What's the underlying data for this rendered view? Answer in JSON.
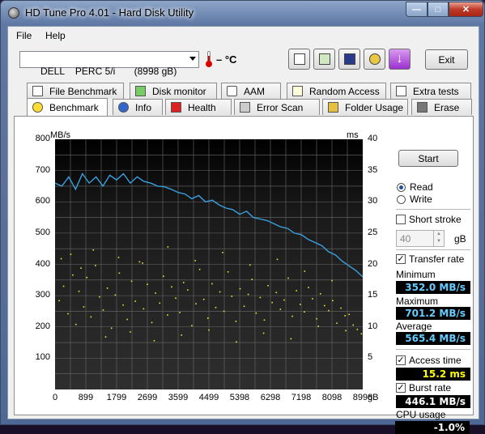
{
  "window": {
    "title": "HD Tune Pro 4.01 - Hard Disk Utility",
    "minimize": "—",
    "maximize": "□",
    "close": "✕"
  },
  "menu": [
    {
      "label": "File"
    },
    {
      "label": "Help"
    }
  ],
  "toolbar": {
    "drive_selected": "DELL    PERC 5/i       (8998 gB)",
    "temperature": "– °C",
    "exit_label": "Exit",
    "icons": [
      "copy-info-icon",
      "copy-screenshot-icon",
      "save-icon",
      "options-icon",
      "download-icon"
    ]
  },
  "tabs_back": [
    {
      "label": "File Benchmark",
      "icon": "file-benchmark-icon"
    },
    {
      "label": "Disk monitor",
      "icon": "disk-monitor-icon"
    },
    {
      "label": "AAM",
      "icon": "speaker-icon"
    },
    {
      "label": "Random Access",
      "icon": "random-access-icon"
    },
    {
      "label": "Extra tests",
      "icon": "extra-tests-icon"
    }
  ],
  "tabs_front": [
    {
      "label": "Benchmark",
      "icon": "benchmark-icon",
      "active": true
    },
    {
      "label": "Info",
      "icon": "info-icon"
    },
    {
      "label": "Health",
      "icon": "health-cross-icon"
    },
    {
      "label": "Error Scan",
      "icon": "error-scan-icon"
    },
    {
      "label": "Folder Usage",
      "icon": "folder-icon"
    },
    {
      "label": "Erase",
      "icon": "trash-icon"
    }
  ],
  "controls": {
    "start_label": "Start",
    "read_label": "Read",
    "write_label": "Write",
    "mode": "Read",
    "short_stroke_label": "Short stroke",
    "short_stroke_checked": false,
    "short_stroke_value": "40",
    "short_stroke_unit": "gB",
    "transfer_rate_label": "Transfer rate",
    "transfer_rate_checked": true,
    "minimum_label": "Minimum",
    "minimum_value": "352.0 MB/s",
    "maximum_label": "Maximum",
    "maximum_value": "701.2 MB/s",
    "average_label": "Average",
    "average_value": "565.4 MB/s",
    "access_time_label": "Access time",
    "access_time_checked": true,
    "access_time_value": "15.2 ms",
    "burst_rate_label": "Burst rate",
    "burst_rate_checked": true,
    "burst_rate_value": "446.1 MB/s",
    "cpu_usage_label": "CPU usage",
    "cpu_usage_value": "-1.0%"
  },
  "colors": {
    "transfer_line": "#3aa0e0",
    "access_points": "#e8e830",
    "chart_bg": "#000000",
    "grid": "#6a6a6a"
  },
  "chart_data": {
    "type": "line",
    "left_axis_label": "MB/s",
    "right_axis_label": "ms",
    "x_unit_label": "gB",
    "x_ticks": [
      "0",
      "899",
      "1799",
      "2699",
      "3599",
      "4499",
      "5398",
      "6298",
      "7198",
      "8098",
      "8998"
    ],
    "y_ticks_left": [
      "800",
      "700",
      "600",
      "500",
      "400",
      "300",
      "200",
      "100"
    ],
    "y_ticks_right": [
      "40",
      "35",
      "30",
      "25",
      "20",
      "15",
      "10",
      "5"
    ],
    "xlim": [
      0,
      8998
    ],
    "ylim_left": [
      0,
      800
    ],
    "ylim_right": [
      0,
      40
    ],
    "grid": true,
    "series": [
      {
        "name": "Transfer rate",
        "axis": "left",
        "x": [
          0,
          200,
          400,
          600,
          800,
          1000,
          1200,
          1400,
          1600,
          1800,
          2000,
          2200,
          2400,
          2600,
          2800,
          3000,
          3200,
          3400,
          3600,
          3800,
          4000,
          4200,
          4400,
          4600,
          4800,
          5000,
          5200,
          5400,
          5600,
          5800,
          6000,
          6200,
          6400,
          6600,
          6800,
          7000,
          7200,
          7400,
          7600,
          7800,
          8000,
          8200,
          8400,
          8600,
          8800,
          8998
        ],
        "y": [
          660,
          650,
          680,
          640,
          690,
          660,
          680,
          650,
          685,
          670,
          690,
          660,
          680,
          665,
          660,
          650,
          648,
          640,
          630,
          625,
          610,
          620,
          600,
          605,
          590,
          580,
          575,
          560,
          570,
          550,
          545,
          540,
          530,
          520,
          515,
          500,
          495,
          480,
          470,
          460,
          440,
          430,
          410,
          395,
          380,
          360
        ]
      },
      {
        "name": "Access time",
        "axis": "right",
        "type": "scatter",
        "x": [
          120,
          250,
          380,
          520,
          610,
          700,
          840,
          930,
          1050,
          1180,
          1300,
          1410,
          1530,
          1650,
          1760,
          1880,
          1990,
          2110,
          2240,
          2350,
          2470,
          2590,
          2700,
          2830,
          2940,
          3060,
          3170,
          3290,
          3410,
          3530,
          3650,
          3760,
          3880,
          4000,
          4120,
          4230,
          4350,
          4470,
          4590,
          4700,
          4820,
          4940,
          5060,
          5170,
          5290,
          5410,
          5530,
          5650,
          5760,
          5880,
          6000,
          6120,
          6230,
          6350,
          6470,
          6590,
          6700,
          6820,
          6940,
          7060,
          7170,
          7290,
          7410,
          7530,
          7650,
          7760,
          7880,
          8000,
          8120,
          8240,
          8360,
          8480,
          8600,
          8720,
          8840,
          8960,
          180,
          460,
          760,
          1120,
          1480,
          1860,
          2200,
          2560,
          2900,
          3300,
          3700,
          4100,
          4500,
          4900,
          5300,
          5700,
          6100,
          6500,
          6900,
          7300,
          7700,
          8100,
          8500
        ],
        "y": [
          14.2,
          16.5,
          12.1,
          18.3,
          10.4,
          15.7,
          13.2,
          17.9,
          11.6,
          19.8,
          14.8,
          12.7,
          16.2,
          9.8,
          15.1,
          18.6,
          13.5,
          11.2,
          17.3,
          14.1,
          20.4,
          12.9,
          16.8,
          10.7,
          15.4,
          13.8,
          18.1,
          11.9,
          16.4,
          14.6,
          12.3,
          17.1,
          15.9,
          10.2,
          13.7,
          19.2,
          14.4,
          11.4,
          16.9,
          13.1,
          15.6,
          12.5,
          18.8,
          14.9,
          10.9,
          16.1,
          13.3,
          15.2,
          17.6,
          12.2,
          14.7,
          11.1,
          16.6,
          13.9,
          15.5,
          12.8,
          14.3,
          17.8,
          11.7,
          15.8,
          13.6,
          12.4,
          16.3,
          14.5,
          11.3,
          15.3,
          13.4,
          12.6,
          14.2,
          10.6,
          13.0,
          11.8,
          12.0,
          10.3,
          9.6,
          8.9,
          20.9,
          21.6,
          19.4,
          22.3,
          8.4,
          21.1,
          9.2,
          20.2,
          7.8,
          22.8,
          8.7,
          20.6,
          9.5,
          21.9,
          7.6,
          19.9,
          9.0,
          20.8,
          8.1,
          18.9,
          10.1,
          17.4,
          9.4
        ]
      }
    ]
  }
}
